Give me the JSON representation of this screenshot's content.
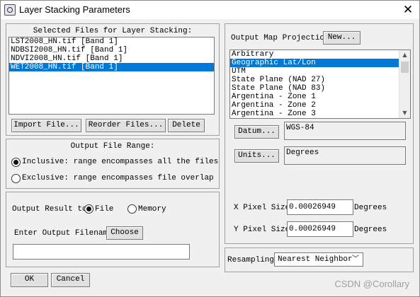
{
  "window": {
    "title": "Layer Stacking Parameters",
    "close_glyph": "✕"
  },
  "selected_files": {
    "heading": "Selected Files for Layer Stacking:",
    "items": [
      "LST2008_HN.tif [Band 1]",
      "NDBSI2008_HN.tif [Band 1]",
      "NDVI2008_HN.tif [Band 1]",
      "WET2008_HN.tif [Band 1]"
    ],
    "selected_index": 3,
    "buttons": {
      "import": "Import File...",
      "reorder": "Reorder Files...",
      "delete": "Delete"
    }
  },
  "output_range": {
    "heading": "Output File Range:",
    "inclusive": "Inclusive: range encompasses all the files",
    "exclusive": "Exclusive: range encompasses file overlap",
    "selected": "inclusive"
  },
  "output_result": {
    "label": "Output Result to",
    "file": "File",
    "memory": "Memory",
    "selected": "file",
    "filename_label": "Enter Output Filename",
    "choose": "Choose",
    "filename_value": ""
  },
  "projection": {
    "label": "Output Map Projection",
    "new_button": "New...",
    "items": [
      "Arbitrary",
      "Geographic Lat/Lon",
      "UTM",
      "State Plane (NAD 27)",
      "State Plane (NAD 83)",
      "Argentina - Zone 1",
      "Argentina - Zone 2",
      "Argentina - Zone 3"
    ],
    "selected_index": 1,
    "datum_button": "Datum...",
    "datum_value": "WGS-84",
    "units_button": "Units...",
    "units_value": "Degrees"
  },
  "pixel_size": {
    "x_label": "X Pixel Size",
    "x_value": "0.00026949",
    "x_unit": "Degrees",
    "y_label": "Y Pixel Size",
    "y_value": "0.00026949",
    "y_unit": "Degrees"
  },
  "resampling": {
    "label": "Resampling",
    "value": "Nearest Neighbor"
  },
  "footer": {
    "ok": "OK",
    "cancel": "Cancel"
  },
  "watermark": "CSDN @Corollary"
}
